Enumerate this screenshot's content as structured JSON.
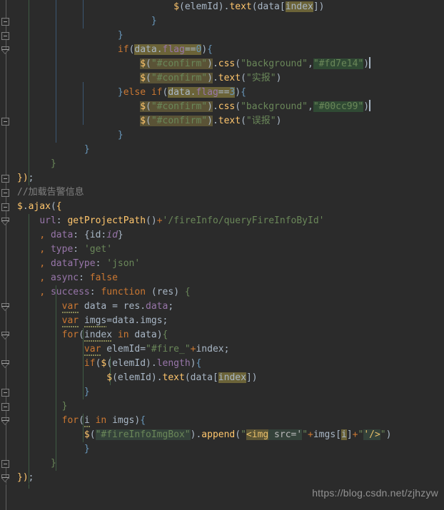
{
  "editor": {
    "theme": "darcula",
    "background": "#2b2b2b",
    "foreground": "#a9b7c6",
    "language": "JavaScript",
    "colors": {
      "keyword": "#cc7832",
      "string": "#6a8759",
      "number": "#6897bb",
      "function": "#ffc66d",
      "property": "#9876aa",
      "comment": "#808080",
      "identifier_highlight": "#6b6338",
      "color_literal_highlight": "#304a34",
      "injected_fragment_highlight": "#34423a",
      "gutter_line": "#606060"
    }
  },
  "code_lines": [
    {
      "indent": 7,
      "text": "$(elemId).text(data[index])"
    },
    {
      "indent": 6,
      "text": "}"
    },
    {
      "indent": 4,
      "text": "}"
    },
    {
      "indent": 4,
      "text": "if(data.flag==0){"
    },
    {
      "indent": 5,
      "text": "$(\"#confirm\").css(\"background\",\"#fd7e14\")"
    },
    {
      "indent": 5,
      "text": "$(\"#confirm\").text(\"实报\")"
    },
    {
      "indent": 4,
      "text": "}else if(data.flag==3){"
    },
    {
      "indent": 5,
      "text": "$(\"#confirm\").css(\"background\",\"#00cc99\")"
    },
    {
      "indent": 5,
      "text": "$(\"#confirm\").text(\"误报\")"
    },
    {
      "indent": 4,
      "text": "}"
    },
    {
      "indent": 3,
      "text": "}"
    },
    {
      "indent": 2,
      "text": "}"
    },
    {
      "indent": 0,
      "text": "});"
    },
    {
      "indent": 0,
      "text": "//加载告警信息"
    },
    {
      "indent": 0,
      "text": "$.ajax({"
    },
    {
      "indent": 1,
      "text": "url: getProjectPath()+'/fireInfo/queryFireInfoById'"
    },
    {
      "indent": 1,
      "text": ", data: {id:id}"
    },
    {
      "indent": 1,
      "text": ", type: 'get'"
    },
    {
      "indent": 1,
      "text": ", dataType: 'json'"
    },
    {
      "indent": 1,
      "text": ", async: false"
    },
    {
      "indent": 1,
      "text": ", success: function (res) {"
    },
    {
      "indent": 2,
      "text": "var data = res.data;"
    },
    {
      "indent": 2,
      "text": "var imgs=data.imgs;"
    },
    {
      "indent": 2,
      "text": "for(index in data){"
    },
    {
      "indent": 3,
      "text": "var elemId=\"#fire_\"+index;"
    },
    {
      "indent": 3,
      "text": "if($(elemId).length){"
    },
    {
      "indent": 4,
      "text": "$(elemId).text(data[index])"
    },
    {
      "indent": 3,
      "text": "}"
    },
    {
      "indent": 2,
      "text": "}"
    },
    {
      "indent": 2,
      "text": "for(i in imgs){"
    },
    {
      "indent": 3,
      "text": "$(\"#fireInfoImgBox\").append(\"<img src='\"+imgs[i]+\"'/>\")"
    },
    {
      "indent": 3,
      "text": "}"
    },
    {
      "indent": 1,
      "text": "}"
    },
    {
      "indent": 0,
      "text": "});"
    }
  ],
  "highlighted_identifiers": [
    "index",
    "$(\"#confirm\")",
    "data.flag==0",
    "data.flag==3",
    "i"
  ],
  "color_literals": [
    "#fd7e14",
    "#00cc99"
  ],
  "injected_html_fragment": "<img src='",
  "injected_html_close": "'/>",
  "comment_text": "//加载告警信息",
  "strings": [
    "实报",
    "误报",
    "'/fireInfo/queryFireInfoById'",
    "'get'",
    "'json'",
    "\"#fire_\"",
    "\"#fireInfoImgBox\"",
    "\"background\""
  ],
  "ajax_options": {
    "url": "getProjectPath()+'/fireInfo/queryFireInfoById'",
    "data": "{id:id}",
    "type": "'get'",
    "dataType": "'json'",
    "async": "false",
    "success": "function (res) {"
  },
  "watermark": {
    "text": "https://blog.csdn.net/zjhzyw"
  }
}
